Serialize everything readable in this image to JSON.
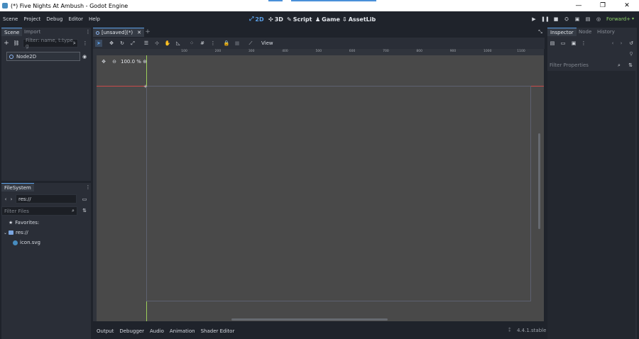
{
  "window": {
    "title": "(*) Five Nights At Ambush - Godot Engine",
    "minimize_glyph": "—",
    "maximize_glyph": "❐",
    "close_glyph": "✕"
  },
  "menu": [
    "Scene",
    "Project",
    "Debug",
    "Editor",
    "Help"
  ],
  "workspaces": [
    {
      "label": "2D",
      "glyph": "⤢",
      "active": true
    },
    {
      "label": "3D",
      "glyph": "✣",
      "active": false
    },
    {
      "label": "Script",
      "glyph": "✎",
      "active": false
    },
    {
      "label": "Game",
      "glyph": "♟",
      "active": false
    },
    {
      "label": "AssetLib",
      "glyph": "⇩",
      "active": false
    }
  ],
  "renderer": "Forward+",
  "scene_dock": {
    "tabs": [
      "Scene",
      "Import"
    ],
    "filter_placeholder": "Filter: name, t:type, g",
    "root_node": "Node2D"
  },
  "filesystem_dock": {
    "tab": "FileSystem",
    "path": "res://",
    "filter_placeholder": "Filter Files",
    "favorites_label": "Favorites:",
    "folder": "res://",
    "file": "icon.svg"
  },
  "editor": {
    "scene_tab": "[unsaved](*)",
    "view_menu": "View",
    "zoom": "100.0 %",
    "ruler_ticks": [
      "100",
      "200",
      "300",
      "400",
      "500",
      "600",
      "700",
      "800",
      "900",
      "1000",
      "1100"
    ]
  },
  "inspector": {
    "tabs": [
      "Inspector",
      "Node",
      "History"
    ],
    "filter_placeholder": "Filter Properties"
  },
  "bottom_panel": {
    "tabs": [
      "Output",
      "Debugger",
      "Audio",
      "Animation",
      "Shader Editor"
    ],
    "version": "4.4.1.stable"
  },
  "colors": {
    "accent": "#5b9fe6",
    "renderer": "#8fd36b",
    "viewport_bg": "#494949",
    "x_axis": "#c94a4a",
    "y_axis": "#9ccf5b"
  }
}
